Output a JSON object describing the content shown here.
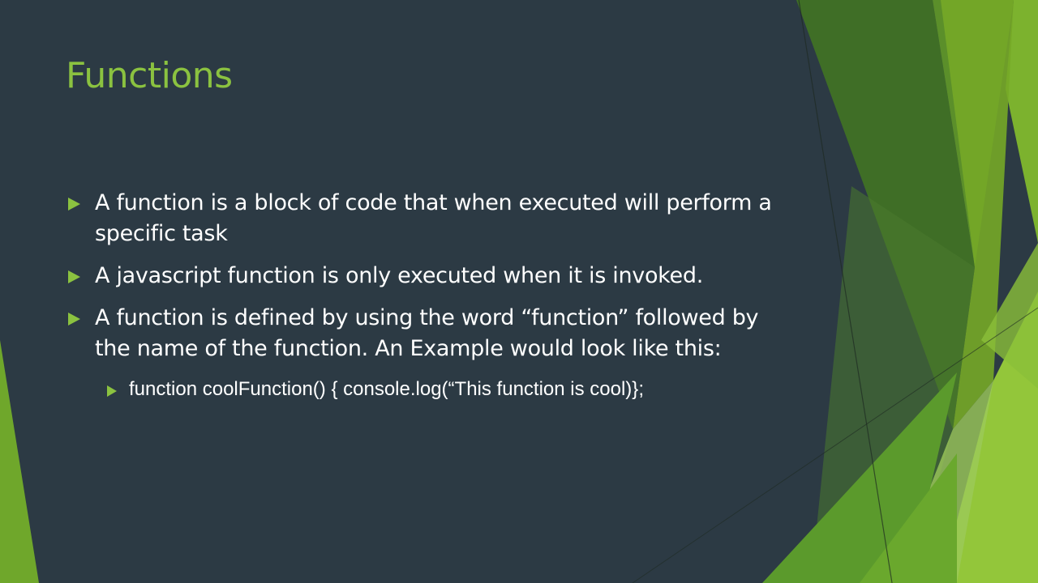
{
  "slide": {
    "title": "Functions",
    "bullets": [
      "A function is a block of code that when executed will perform a specific task",
      "A javascript function is only executed when it is invoked.",
      "A function is defined by using the word “function” followed by the name of the function. An Example would look like this:"
    ],
    "sub_bullets": [
      "function coolFunction() { console.log(“This function is cool)};"
    ]
  },
  "colors": {
    "background": "#2c3a44",
    "accent": "#8bc240",
    "text": "#ffffff"
  }
}
